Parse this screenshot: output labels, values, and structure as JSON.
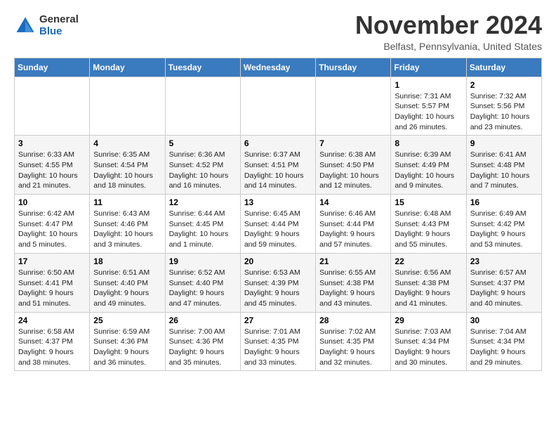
{
  "header": {
    "logo": {
      "general": "General",
      "blue": "Blue"
    },
    "title": "November 2024",
    "location": "Belfast, Pennsylvania, United States"
  },
  "weekdays": [
    "Sunday",
    "Monday",
    "Tuesday",
    "Wednesday",
    "Thursday",
    "Friday",
    "Saturday"
  ],
  "weeks": [
    [
      {
        "day": "",
        "info": ""
      },
      {
        "day": "",
        "info": ""
      },
      {
        "day": "",
        "info": ""
      },
      {
        "day": "",
        "info": ""
      },
      {
        "day": "",
        "info": ""
      },
      {
        "day": "1",
        "info": "Sunrise: 7:31 AM\nSunset: 5:57 PM\nDaylight: 10 hours and 26 minutes."
      },
      {
        "day": "2",
        "info": "Sunrise: 7:32 AM\nSunset: 5:56 PM\nDaylight: 10 hours and 23 minutes."
      }
    ],
    [
      {
        "day": "3",
        "info": "Sunrise: 6:33 AM\nSunset: 4:55 PM\nDaylight: 10 hours and 21 minutes."
      },
      {
        "day": "4",
        "info": "Sunrise: 6:35 AM\nSunset: 4:54 PM\nDaylight: 10 hours and 18 minutes."
      },
      {
        "day": "5",
        "info": "Sunrise: 6:36 AM\nSunset: 4:52 PM\nDaylight: 10 hours and 16 minutes."
      },
      {
        "day": "6",
        "info": "Sunrise: 6:37 AM\nSunset: 4:51 PM\nDaylight: 10 hours and 14 minutes."
      },
      {
        "day": "7",
        "info": "Sunrise: 6:38 AM\nSunset: 4:50 PM\nDaylight: 10 hours and 12 minutes."
      },
      {
        "day": "8",
        "info": "Sunrise: 6:39 AM\nSunset: 4:49 PM\nDaylight: 10 hours and 9 minutes."
      },
      {
        "day": "9",
        "info": "Sunrise: 6:41 AM\nSunset: 4:48 PM\nDaylight: 10 hours and 7 minutes."
      }
    ],
    [
      {
        "day": "10",
        "info": "Sunrise: 6:42 AM\nSunset: 4:47 PM\nDaylight: 10 hours and 5 minutes."
      },
      {
        "day": "11",
        "info": "Sunrise: 6:43 AM\nSunset: 4:46 PM\nDaylight: 10 hours and 3 minutes."
      },
      {
        "day": "12",
        "info": "Sunrise: 6:44 AM\nSunset: 4:45 PM\nDaylight: 10 hours and 1 minute."
      },
      {
        "day": "13",
        "info": "Sunrise: 6:45 AM\nSunset: 4:44 PM\nDaylight: 9 hours and 59 minutes."
      },
      {
        "day": "14",
        "info": "Sunrise: 6:46 AM\nSunset: 4:44 PM\nDaylight: 9 hours and 57 minutes."
      },
      {
        "day": "15",
        "info": "Sunrise: 6:48 AM\nSunset: 4:43 PM\nDaylight: 9 hours and 55 minutes."
      },
      {
        "day": "16",
        "info": "Sunrise: 6:49 AM\nSunset: 4:42 PM\nDaylight: 9 hours and 53 minutes."
      }
    ],
    [
      {
        "day": "17",
        "info": "Sunrise: 6:50 AM\nSunset: 4:41 PM\nDaylight: 9 hours and 51 minutes."
      },
      {
        "day": "18",
        "info": "Sunrise: 6:51 AM\nSunset: 4:40 PM\nDaylight: 9 hours and 49 minutes."
      },
      {
        "day": "19",
        "info": "Sunrise: 6:52 AM\nSunset: 4:40 PM\nDaylight: 9 hours and 47 minutes."
      },
      {
        "day": "20",
        "info": "Sunrise: 6:53 AM\nSunset: 4:39 PM\nDaylight: 9 hours and 45 minutes."
      },
      {
        "day": "21",
        "info": "Sunrise: 6:55 AM\nSunset: 4:38 PM\nDaylight: 9 hours and 43 minutes."
      },
      {
        "day": "22",
        "info": "Sunrise: 6:56 AM\nSunset: 4:38 PM\nDaylight: 9 hours and 41 minutes."
      },
      {
        "day": "23",
        "info": "Sunrise: 6:57 AM\nSunset: 4:37 PM\nDaylight: 9 hours and 40 minutes."
      }
    ],
    [
      {
        "day": "24",
        "info": "Sunrise: 6:58 AM\nSunset: 4:37 PM\nDaylight: 9 hours and 38 minutes."
      },
      {
        "day": "25",
        "info": "Sunrise: 6:59 AM\nSunset: 4:36 PM\nDaylight: 9 hours and 36 minutes."
      },
      {
        "day": "26",
        "info": "Sunrise: 7:00 AM\nSunset: 4:36 PM\nDaylight: 9 hours and 35 minutes."
      },
      {
        "day": "27",
        "info": "Sunrise: 7:01 AM\nSunset: 4:35 PM\nDaylight: 9 hours and 33 minutes."
      },
      {
        "day": "28",
        "info": "Sunrise: 7:02 AM\nSunset: 4:35 PM\nDaylight: 9 hours and 32 minutes."
      },
      {
        "day": "29",
        "info": "Sunrise: 7:03 AM\nSunset: 4:34 PM\nDaylight: 9 hours and 30 minutes."
      },
      {
        "day": "30",
        "info": "Sunrise: 7:04 AM\nSunset: 4:34 PM\nDaylight: 9 hours and 29 minutes."
      }
    ]
  ]
}
